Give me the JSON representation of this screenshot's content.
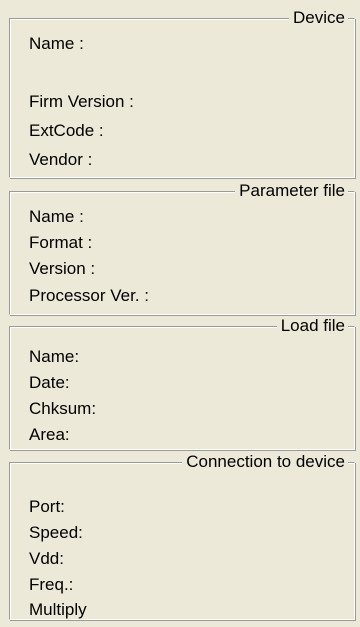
{
  "device": {
    "title": "Device",
    "name_label": "Name :",
    "firm_version_label": "Firm Version :",
    "extcode_label": "ExtCode :",
    "vendor_label": "Vendor :"
  },
  "parameter_file": {
    "title": "Parameter file",
    "name_label": "Name :",
    "format_label": "Format :",
    "version_label": "Version :",
    "processor_ver_label": "Processor Ver. :"
  },
  "load_file": {
    "title": "Load file",
    "name_label": "Name:",
    "date_label": "Date:",
    "chksum_label": "Chksum:",
    "area_label": "Area:"
  },
  "connection": {
    "title": "Connection to device",
    "port_label": "Port:",
    "speed_label": "Speed:",
    "vdd_label": "Vdd:",
    "freq_label": "Freq.:",
    "multiply_label": "Multiply"
  }
}
